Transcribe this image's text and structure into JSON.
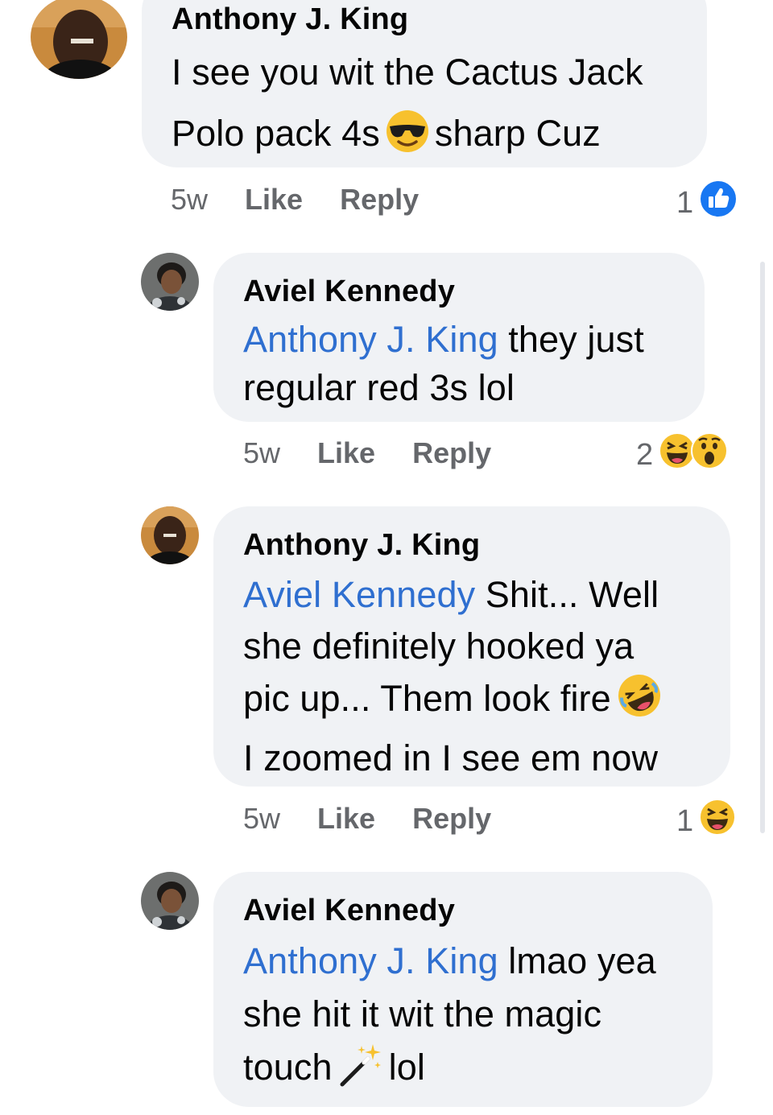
{
  "comments": [
    {
      "author": "Anthony J. King",
      "line1": "I see you wit the Cactus Jack",
      "line2_before": "Polo pack 4s",
      "line2_emoji": "sunglasses-emoji",
      "line2_after": "sharp Cuz",
      "time": "5w",
      "like": "Like",
      "reply": "Reply",
      "reaction_count": "1",
      "reaction_icons": [
        "like-reaction-icon"
      ]
    },
    {
      "author": "Aviel Kennedy",
      "mention": "Anthony J. King",
      "text_after_mention": " they just",
      "line2": "regular red 3s lol",
      "time": "5w",
      "like": "Like",
      "reply": "Reply",
      "reaction_count": "2",
      "reaction_icons": [
        "haha-reaction-icon",
        "wow-reaction-icon"
      ]
    },
    {
      "author": "Anthony J. King",
      "mention": "Aviel Kennedy",
      "text_after_mention": " Shit... Well",
      "line2": "she definitely hooked ya",
      "line3": "pic up... Them look fire",
      "line3_emoji": "rolling-laughing-emoji",
      "line4": "I zoomed in I see em now",
      "time": "5w",
      "like": "Like",
      "reply": "Reply",
      "reaction_count": "1",
      "reaction_icons": [
        "haha-reaction-icon"
      ]
    },
    {
      "author": "Aviel Kennedy",
      "mention": "Anthony J. King",
      "text_after_mention": " lmao yea",
      "line2": "she hit it wit the magic",
      "line3_before": "touch",
      "line3_emoji": "magic-wand-emoji",
      "line3_after": "lol"
    }
  ],
  "colors": {
    "bubble": "#f0f2f5",
    "mention": "#2f6fd0",
    "meta": "#65676b",
    "like_blue": "#1877f2",
    "emoji_yellow": "#f7c12e"
  }
}
